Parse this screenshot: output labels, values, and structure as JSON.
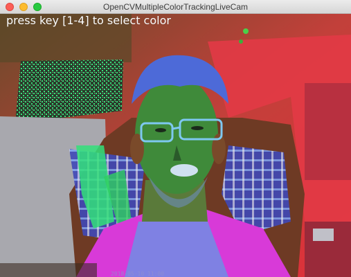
{
  "window": {
    "title": "OpenCVMultipleColorTrackingLiveCam"
  },
  "camera": {
    "instruction_text": "press key [1-4] to select color",
    "timestamp_text": "2018-05-10 11:00"
  },
  "colors": {
    "background_red": "#e8303a",
    "face_green": "#3f8a3a",
    "hair_blue": "#4d6ad8",
    "shirt_magenta": "#d83ad8",
    "highlight_green": "#33e07a",
    "wall_gray": "#a8a8ae"
  }
}
